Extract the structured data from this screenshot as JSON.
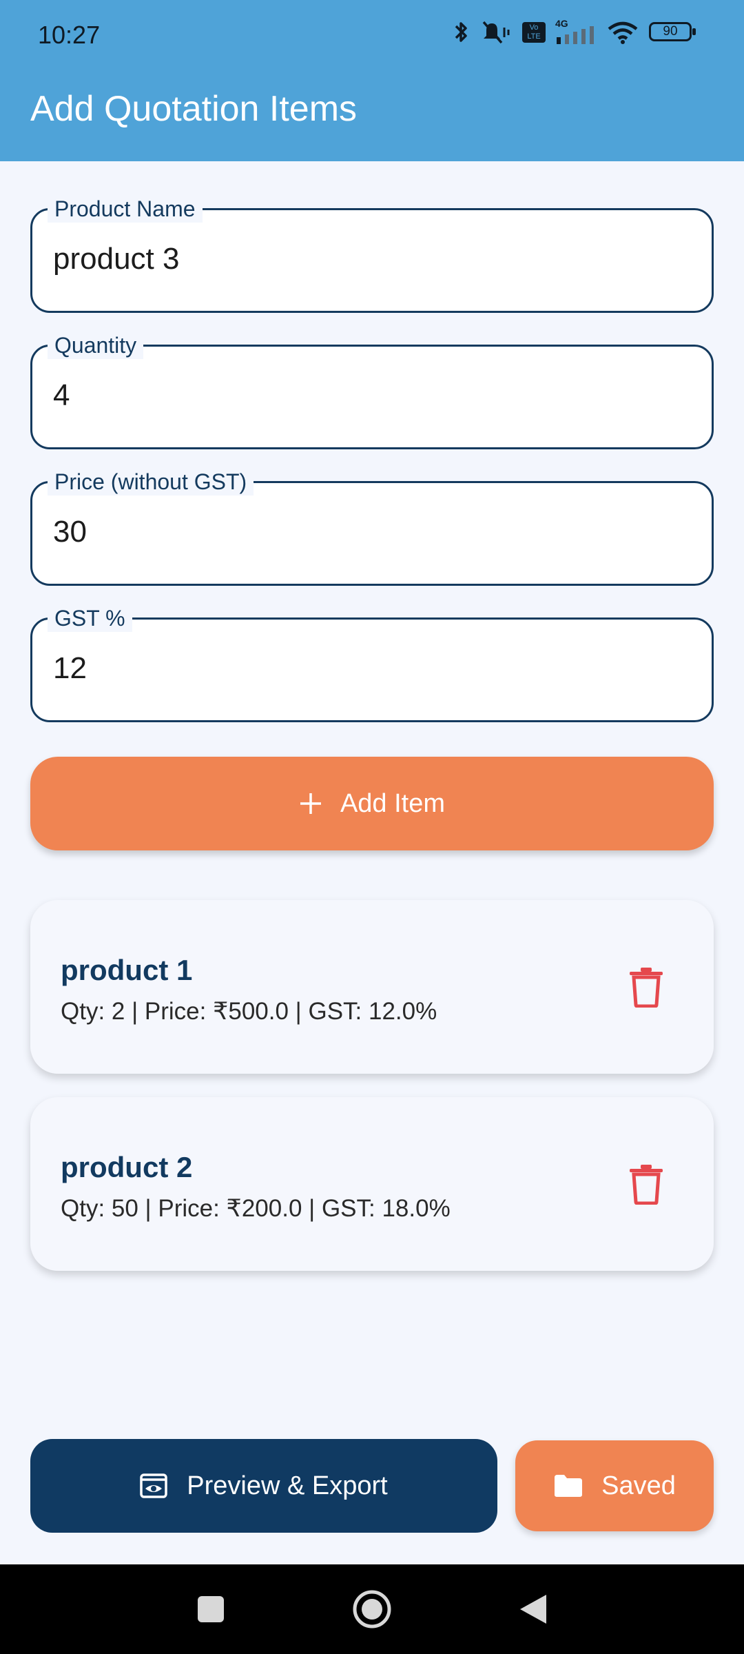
{
  "status_bar": {
    "time": "10:27",
    "network": "4G",
    "volte": "Vo LTE",
    "battery": "90",
    "icons": [
      "bluetooth-icon",
      "mute-vibrate-icon",
      "volte-icon",
      "signal-icon",
      "wifi-icon",
      "battery-icon"
    ]
  },
  "appbar": {
    "title": "Add Quotation Items"
  },
  "form": {
    "fields": [
      {
        "label": "Product Name",
        "value": "product 3"
      },
      {
        "label": "Quantity",
        "value": "4"
      },
      {
        "label": "Price (without GST)",
        "value": "30"
      },
      {
        "label": "GST %",
        "value": "12"
      }
    ],
    "add_button": {
      "label": "Add Item",
      "icon": "plus-icon"
    }
  },
  "items": [
    {
      "name": "product 1",
      "details": "Qty: 2 | Price: ₹500.0 | GST: 12.0%"
    },
    {
      "name": "product 2",
      "details": "Qty: 50 | Price: ₹200.0 | GST: 18.0%"
    }
  ],
  "bottom_actions": {
    "preview": {
      "label": "Preview & Export",
      "icon": "preview-icon"
    },
    "saved": {
      "label": "Saved",
      "icon": "folder-icon"
    }
  },
  "colors": {
    "appbar": "#4fa3d8",
    "accent_orange": "#f08452",
    "primary_navy": "#103a62",
    "delete_red": "#e5484d",
    "background": "#f3f6fd"
  },
  "nav": {
    "items": [
      "recents-icon",
      "home-icon",
      "back-icon"
    ]
  }
}
